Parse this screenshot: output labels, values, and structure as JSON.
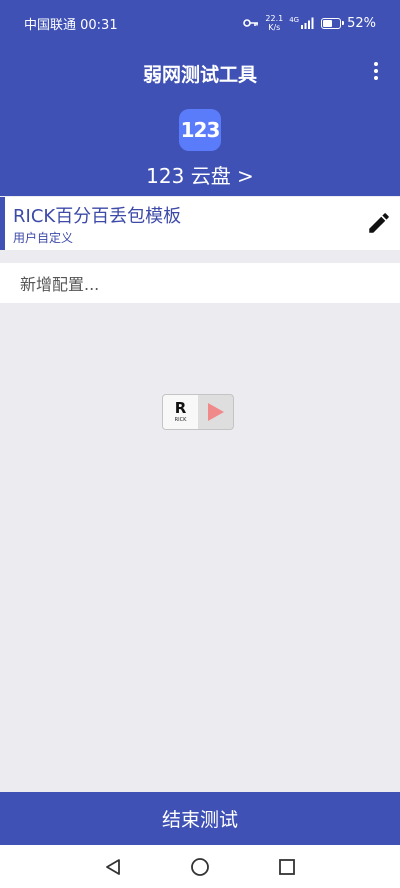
{
  "status_bar": {
    "carrier_time": "中国联通 00:31",
    "net_speed_value": "22.1",
    "net_speed_unit": "K/s",
    "signal_type": "4G",
    "battery_percent": "52%",
    "battery_level": 0.52
  },
  "header": {
    "title": "弱网测试工具",
    "app_logo_text": "123",
    "profile_name": "123 云盘 >"
  },
  "template": {
    "title": "RICK百分百丢包模板",
    "subtitle": "用户自定义"
  },
  "add_config": {
    "label": "新增配置..."
  },
  "widget": {
    "logo_letter": "R",
    "logo_label": "RICK"
  },
  "footer": {
    "end_button": "结束测试"
  },
  "colors": {
    "primary": "#3f51b5",
    "background": "#ebebf0",
    "logo_blue": "#5b7cfa",
    "play_red": "#f08a8a"
  },
  "icons": {
    "vpn": "key-icon",
    "signal": "signal-bars-icon",
    "battery": "battery-icon",
    "menu": "more-vertical-icon",
    "edit": "pencil-icon",
    "play": "play-icon",
    "back": "back-triangle-icon",
    "home": "home-circle-icon",
    "recents": "recents-square-icon"
  }
}
